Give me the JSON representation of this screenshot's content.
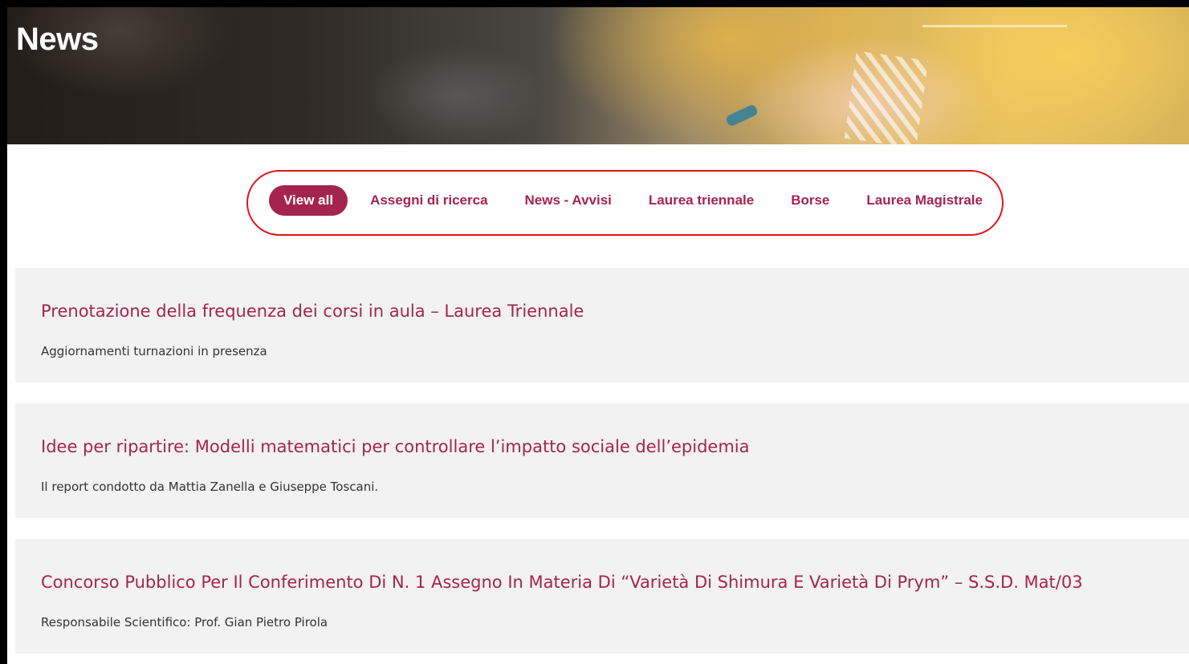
{
  "header": {
    "title": "News"
  },
  "filters": [
    {
      "label": "View all",
      "active": true
    },
    {
      "label": "Assegni di ricerca",
      "active": false
    },
    {
      "label": "News - Avvisi",
      "active": false
    },
    {
      "label": "Laurea triennale",
      "active": false
    },
    {
      "label": "Borse",
      "active": false
    },
    {
      "label": "Laurea Magistrale",
      "active": false
    }
  ],
  "posts": [
    {
      "title": "Prenotazione della frequenza dei corsi in aula – Laurea Triennale",
      "subtitle": "Aggiornamenti turnazioni in presenza"
    },
    {
      "title": "Idee per ripartire: Modelli matematici per controllare l’impatto sociale dell’epidemia",
      "subtitle": "Il report condotto da Mattia Zanella e Giuseppe Toscani."
    },
    {
      "title": "Concorso Pubblico Per Il Conferimento Di N. 1 Assegno In Materia Di “Varietà Di Shimura E Varietà Di Prym” – S.S.D. Mat/03",
      "subtitle": "Responsabile Scientifico: Prof. Gian Pietro Pirola"
    }
  ],
  "colors": {
    "accent": "#a4244f",
    "highlight_outline": "#e0141b",
    "card_background": "#f2f2f2"
  }
}
